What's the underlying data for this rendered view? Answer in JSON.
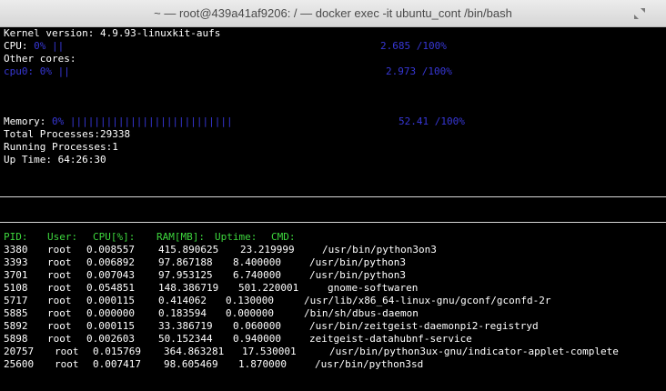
{
  "window": {
    "title": "~ — root@439a41af9206: / — docker exec -it ubuntu_cont /bin/bash"
  },
  "header": {
    "kernel": "Kernel version: 4.9.93-linuxkit-aufs",
    "cpu_label": "CPU:",
    "cpu_bar": "0% ||",
    "cpu_value": "2.685 /100%",
    "other_cores": "Other cores:",
    "core0_bar": "cpu0: 0% ||",
    "core0_value": "2.973 /100%",
    "memory_label": "Memory:",
    "memory_bar": "0% |||||||||||||||||||||||||||",
    "memory_value": "52.41 /100%",
    "total_processes": "Total Processes:29338",
    "running_processes": "Running Processes:1",
    "uptime": "Up Time: 64:26:30"
  },
  "table": {
    "headers": [
      "PID:",
      "User:",
      "CPU[%]:",
      "RAM[MB]:",
      "Uptime:",
      "CMD:"
    ],
    "rows": [
      {
        "pid": "3380",
        "user": "root",
        "cpu": "0.008557",
        "ram": "415.890625",
        "uptime": "23.219999",
        "cmd": "/usr/bin/python3on3"
      },
      {
        "pid": "3393",
        "user": "root",
        "cpu": "0.006892",
        "ram": "97.867188",
        "uptime": "8.400000",
        "cmd": "/usr/bin/python3"
      },
      {
        "pid": "3701",
        "user": "root",
        "cpu": "0.007043",
        "ram": "97.953125",
        "uptime": "6.740000",
        "cmd": "/usr/bin/python3"
      },
      {
        "pid": "5108",
        "user": "root",
        "cpu": "0.054851",
        "ram": "148.386719",
        "uptime": "501.220001",
        "cmd": "gnome-softwaren"
      },
      {
        "pid": "5717",
        "user": "root",
        "cpu": "0.000115",
        "ram": "0.414062",
        "uptime": "0.130000",
        "cmd": "/usr/lib/x86_64-linux-gnu/gconf/gconfd-2r"
      },
      {
        "pid": "5885",
        "user": "root",
        "cpu": "0.000000",
        "ram": "0.183594",
        "uptime": "0.000000",
        "cmd": "/bin/sh/dbus-daemon"
      },
      {
        "pid": "5892",
        "user": "root",
        "cpu": "0.000115",
        "ram": "33.386719",
        "uptime": "0.060000",
        "cmd": "/usr/bin/zeitgeist-daemonpi2-registryd"
      },
      {
        "pid": "5898",
        "user": "root",
        "cpu": "0.002603",
        "ram": "50.152344",
        "uptime": "0.940000",
        "cmd": "zeitgeist-datahubnf-service"
      },
      {
        "pid": "20757",
        "user": "root",
        "cpu": "0.015769",
        "ram": "364.863281",
        "uptime": "17.530001",
        "cmd": "/usr/bin/python3ux-gnu/indicator-applet-complete"
      },
      {
        "pid": "25600",
        "user": "root",
        "cpu": "0.007417",
        "ram": "98.605469",
        "uptime": "1.870000",
        "cmd": "/usr/bin/python3sd"
      }
    ]
  },
  "colors": {
    "background": "#000000",
    "text": "#ffffff",
    "bar": "#3737d6",
    "header_green": "#3dd63d"
  },
  "icons": {
    "fullscreen": "fullscreen-arrows-icon"
  }
}
